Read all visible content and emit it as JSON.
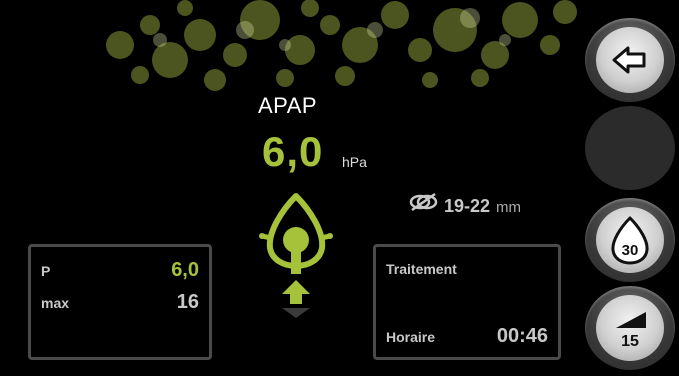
{
  "mode_label": "APAP",
  "pressure": {
    "value": "6,0",
    "unit": "hPa"
  },
  "tube": {
    "symbol": "tube-diameter-icon",
    "value": "19-22",
    "unit": "mm"
  },
  "left_panel": {
    "rows": [
      {
        "label": "P",
        "value": "6,0"
      },
      {
        "label": "max",
        "value": "16"
      }
    ]
  },
  "right_panel": {
    "title": "Traitement",
    "hour_label": "Horaire",
    "hour_value": "00:46"
  },
  "side_buttons": {
    "back": {
      "icon": "back-arrow-icon"
    },
    "mask_fit": {
      "icon": "mask-fit-icon",
      "value": "30"
    },
    "ramp": {
      "icon": "ramp-icon",
      "value": "15"
    }
  },
  "colors": {
    "accent": "#a6c13a",
    "text": "#c8c8c8",
    "panel_border": "#4a4a4a"
  }
}
